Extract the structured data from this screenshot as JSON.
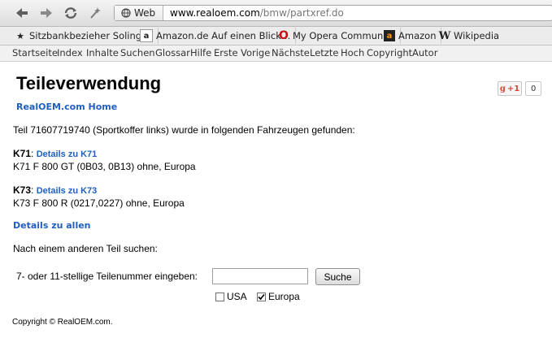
{
  "browser": {
    "address_badge": "Web",
    "url_host": "www.realoem.com",
    "url_path": "/bmw/partxref.do"
  },
  "bookmarks": [
    {
      "label": "Sitzbankbezieher Solingen",
      "icon": "star-icon"
    },
    {
      "label": "Amazon.de Auf einen Blick…",
      "icon": "amazon-icon"
    },
    {
      "label": "My Opera Community",
      "icon": "opera-icon"
    },
    {
      "label": "Amazon",
      "icon": "amazon-icon"
    },
    {
      "label": "Wikipedia",
      "icon": "wikipedia-icon"
    }
  ],
  "nav": [
    "Startseite",
    "Index",
    "Inhalte",
    "Suchen",
    "Glossar",
    "Hilfe",
    "Erste",
    "Vorige",
    "Nächste",
    "Letzte",
    "Hoch",
    "Copyright",
    "Autor"
  ],
  "page": {
    "title": "Teileverwendung",
    "home_link": "RealOEM.com Home",
    "gplus_label": "+1",
    "gplus_count": "0",
    "intro": "Teil 71607719740 (Sportkoffer links) wurde in folgenden Fahrzeugen gefunden:",
    "results": [
      {
        "code": "K71",
        "link": "Details zu K71",
        "desc": "K71 F 800 GT (0B03, 0B13) ohne, Europa"
      },
      {
        "code": "K73",
        "link": "Details zu K73",
        "desc": "K73 F 800 R (0217,0227) ohne, Europa"
      }
    ],
    "details_all": "Details zu allen",
    "search_heading": "Nach einem anderen Teil suchen:",
    "search_label": "7- oder 11-stellige Teilenummer eingeben:",
    "search_value": "",
    "search_button": "Suche",
    "region_usa": "USA",
    "region_europa": "Europa",
    "usa_checked": false,
    "europa_checked": true,
    "copyright": "Copyright © RealOEM.com."
  }
}
